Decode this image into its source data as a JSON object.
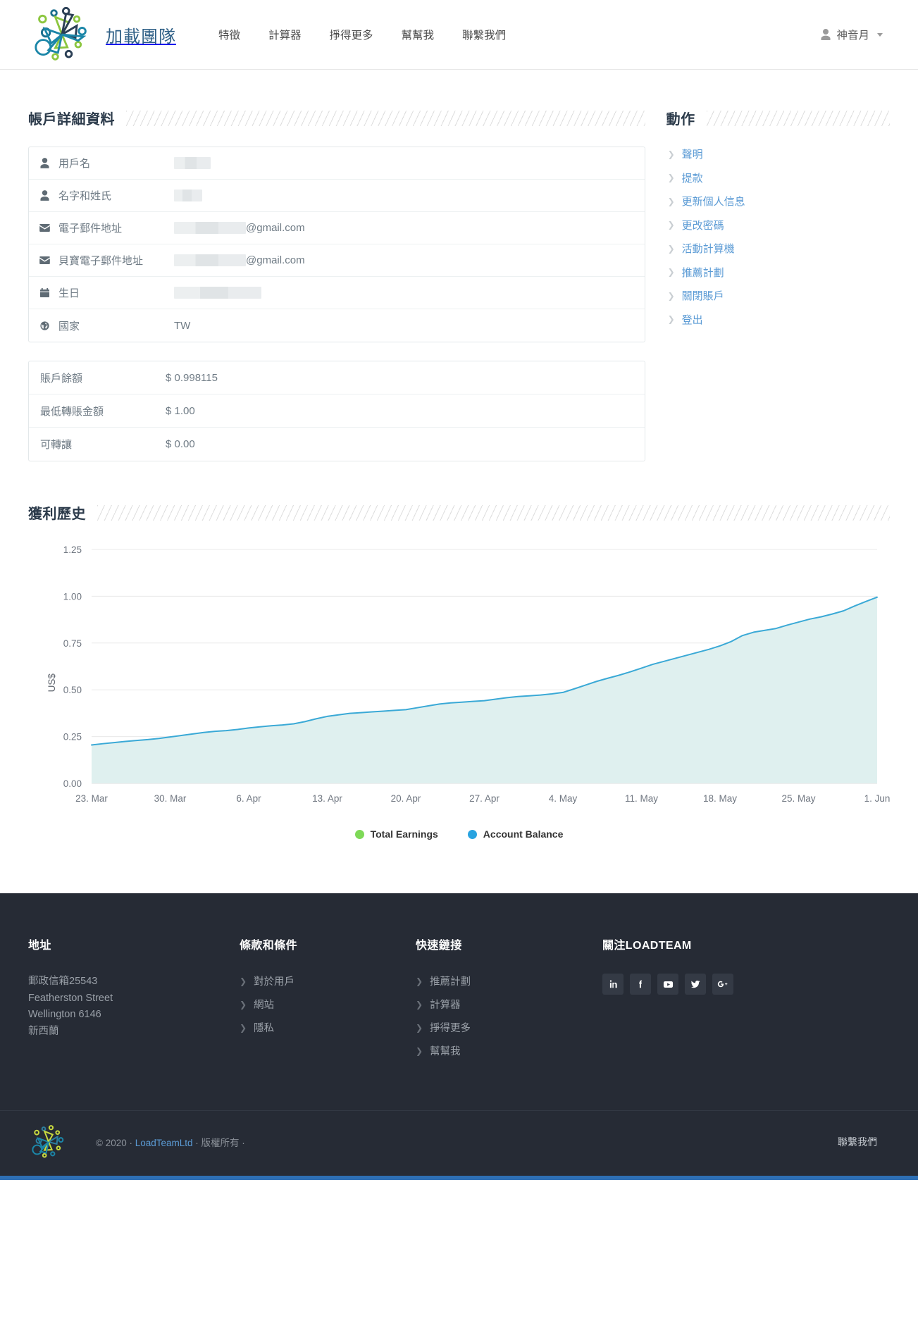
{
  "header": {
    "brand": "加載團隊",
    "nav": [
      {
        "label": "特徵"
      },
      {
        "label": "計算器"
      },
      {
        "label": "掙得更多"
      },
      {
        "label": "幫幫我"
      },
      {
        "label": "聯繫我們"
      }
    ],
    "user": {
      "name": "神音月",
      "icon": "person-icon",
      "caret": "▾"
    }
  },
  "account": {
    "section_title": "帳戶詳細資料",
    "rows": [
      {
        "icon": "person-icon",
        "label": "用戶名",
        "value": "",
        "redacted": true,
        "suffix": ""
      },
      {
        "icon": "person-icon",
        "label": "名字和姓氏",
        "value": "",
        "redacted": true,
        "suffix": ""
      },
      {
        "icon": "envelope-icon",
        "label": "電子郵件地址",
        "value": "",
        "redacted": true,
        "suffix": "@gmail.com"
      },
      {
        "icon": "envelope-icon",
        "label": "貝寶電子郵件地址",
        "value": "",
        "redacted": true,
        "suffix": "@gmail.com"
      },
      {
        "icon": "calendar-icon",
        "label": "生日",
        "value": "",
        "redacted": true,
        "suffix": ""
      },
      {
        "icon": "globe-icon",
        "label": "國家",
        "value": "TW",
        "redacted": false,
        "suffix": ""
      }
    ]
  },
  "balances": {
    "rows": [
      {
        "label": "賬戶餘額",
        "value": "$ 0.998115",
        "color": "#2ab35b"
      },
      {
        "label": "最低轉賬金額",
        "value": "$ 1.00",
        "color": "#3e8fd6"
      },
      {
        "label": "可轉讓",
        "value": "$ 0.00",
        "color": "#7c8790"
      }
    ]
  },
  "actions": {
    "section_title": "動作",
    "items": [
      {
        "label": "聲明"
      },
      {
        "label": "提款"
      },
      {
        "label": "更新個人信息"
      },
      {
        "label": "更改密碼"
      },
      {
        "label": "活動計算機"
      },
      {
        "label": "推薦計劃"
      },
      {
        "label": "關閉賬戶"
      },
      {
        "label": "登出"
      }
    ]
  },
  "earnings": {
    "section_title": "獲利歷史"
  },
  "chart_data": {
    "type": "area",
    "title": "獲利歷史",
    "xlabel": "",
    "ylabel": "US$",
    "ylim": [
      0.0,
      1.25
    ],
    "yticks": [
      "0.00",
      "0.25",
      "0.50",
      "0.75",
      "1.00",
      "1.25"
    ],
    "ytick_values": [
      0.0,
      0.25,
      0.5,
      0.75,
      1.0,
      1.25
    ],
    "xticks": [
      "23. Mar",
      "30. Mar",
      "6. Apr",
      "13. Apr",
      "20. Apr",
      "27. Apr",
      "4. May",
      "11. May",
      "18. May",
      "25. May",
      "1. Jun"
    ],
    "grid": true,
    "legend_position": "bottom",
    "legend": [
      {
        "name": "Total Earnings",
        "color": "#7ed957"
      },
      {
        "name": "Account Balance",
        "color": "#29a3e0"
      }
    ],
    "series": [
      {
        "name": "Account Balance",
        "color": "#3aa9d6",
        "fill": "#dff0ef",
        "x": [
          "23. Mar",
          "24. Mar",
          "25. Mar",
          "26. Mar",
          "27. Mar",
          "28. Mar",
          "29. Mar",
          "30. Mar",
          "31. Mar",
          "1. Apr",
          "2. Apr",
          "3. Apr",
          "4. Apr",
          "5. Apr",
          "6. Apr",
          "7. Apr",
          "8. Apr",
          "9. Apr",
          "10. Apr",
          "11. Apr",
          "12. Apr",
          "13. Apr",
          "14. Apr",
          "15. Apr",
          "16. Apr",
          "17. Apr",
          "18. Apr",
          "19. Apr",
          "20. Apr",
          "21. Apr",
          "22. Apr",
          "23. Apr",
          "24. Apr",
          "25. Apr",
          "26. Apr",
          "27. Apr",
          "28. Apr",
          "29. Apr",
          "30. Apr",
          "1. May",
          "2. May",
          "3. May",
          "4. May",
          "5. May",
          "6. May",
          "7. May",
          "8. May",
          "9. May",
          "10. May",
          "11. May",
          "12. May",
          "13. May",
          "14. May",
          "15. May",
          "16. May",
          "17. May",
          "18. May",
          "19. May",
          "20. May",
          "21. May",
          "22. May",
          "23. May",
          "24. May",
          "25. May",
          "26. May",
          "27. May",
          "28. May",
          "29. May",
          "30. May",
          "31. May",
          "1. Jun"
        ],
        "values": [
          0.205,
          0.212,
          0.218,
          0.224,
          0.229,
          0.234,
          0.24,
          0.248,
          0.256,
          0.264,
          0.272,
          0.278,
          0.282,
          0.288,
          0.296,
          0.302,
          0.308,
          0.312,
          0.318,
          0.33,
          0.345,
          0.358,
          0.366,
          0.374,
          0.378,
          0.382,
          0.386,
          0.39,
          0.394,
          0.404,
          0.414,
          0.424,
          0.43,
          0.434,
          0.438,
          0.442,
          0.45,
          0.458,
          0.464,
          0.468,
          0.472,
          0.478,
          0.486,
          0.505,
          0.525,
          0.545,
          0.562,
          0.578,
          0.596,
          0.616,
          0.636,
          0.652,
          0.668,
          0.684,
          0.7,
          0.716,
          0.735,
          0.758,
          0.79,
          0.808,
          0.818,
          0.828,
          0.846,
          0.862,
          0.878,
          0.89,
          0.905,
          0.922,
          0.948,
          0.972,
          0.995
        ]
      }
    ]
  },
  "footer": {
    "address": {
      "title": "地址",
      "lines": [
        "郵政信箱25543",
        "Featherston Street",
        "Wellington 6146",
        "新西蘭"
      ]
    },
    "terms": {
      "title": "條款和條件",
      "links": [
        {
          "label": "對於用戶"
        },
        {
          "label": "網站"
        },
        {
          "label": "隱私"
        }
      ]
    },
    "quick": {
      "title": "快速鏈接",
      "links": [
        {
          "label": "推薦計劃"
        },
        {
          "label": "計算器"
        },
        {
          "label": "掙得更多"
        },
        {
          "label": "幫幫我"
        }
      ]
    },
    "follow": {
      "title": "關注LOADTEAM",
      "socials": [
        {
          "name": "linkedin-icon",
          "glyph": "in"
        },
        {
          "name": "facebook-icon",
          "glyph": "f"
        },
        {
          "name": "youtube-icon",
          "glyph": "You"
        },
        {
          "name": "twitter-icon",
          "glyph": "t"
        },
        {
          "name": "googleplus-icon",
          "glyph": "g+"
        }
      ]
    },
    "bottom": {
      "copy_prefix": "© 2020 · ",
      "company": "LoadTeamLtd",
      "copy_suffix": " · 版權所有 ·",
      "contact": "聯繫我們"
    }
  }
}
